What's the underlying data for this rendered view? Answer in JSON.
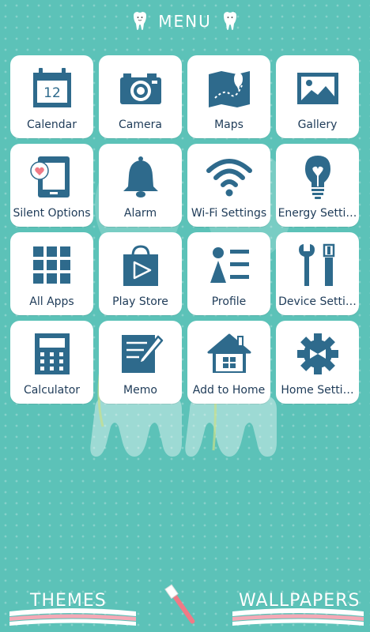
{
  "header": {
    "title": "MENU"
  },
  "tiles": [
    {
      "label": "Calendar",
      "icon": "calendar-icon",
      "day": "12"
    },
    {
      "label": "Camera",
      "icon": "camera-icon"
    },
    {
      "label": "Maps",
      "icon": "map-icon"
    },
    {
      "label": "Gallery",
      "icon": "image-icon"
    },
    {
      "label": "Silent Options",
      "icon": "silent-phone-icon"
    },
    {
      "label": "Alarm",
      "icon": "bell-icon"
    },
    {
      "label": "Wi-Fi Settings",
      "icon": "wifi-icon"
    },
    {
      "label": "Energy Setti…",
      "icon": "lightbulb-icon"
    },
    {
      "label": "All Apps",
      "icon": "grid-icon"
    },
    {
      "label": "Play Store",
      "icon": "shopping-bag-icon"
    },
    {
      "label": "Profile",
      "icon": "profile-icon"
    },
    {
      "label": "Device Setti…",
      "icon": "tools-icon"
    },
    {
      "label": "Calculator",
      "icon": "calculator-icon"
    },
    {
      "label": "Memo",
      "icon": "memo-icon"
    },
    {
      "label": "Add to Home",
      "icon": "house-icon"
    },
    {
      "label": "Home Setti…",
      "icon": "gear-icon"
    }
  ],
  "bottom": {
    "themes_label": "THEMES",
    "wallpapers_label": "WALLPAPERS"
  },
  "colors": {
    "background": "#5cc2b8",
    "icon": "#2e6a8c",
    "label": "#1e3b58",
    "tile": "#ffffff"
  }
}
